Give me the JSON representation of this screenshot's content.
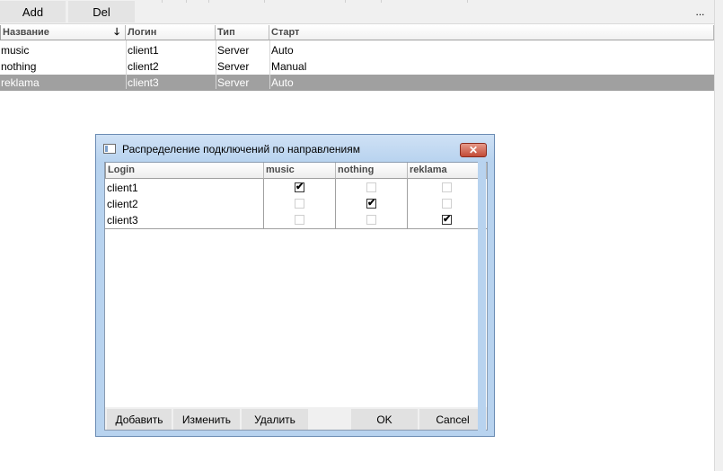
{
  "toolbar": {
    "add_label": "Add",
    "del_label": "Del",
    "more_label": "..."
  },
  "grid": {
    "columns": [
      "Название",
      "Логин",
      "Тип",
      "Старт"
    ],
    "sort_indicator": "🡓",
    "rows": [
      {
        "name": "music",
        "login": "client1",
        "type": "Server",
        "start": "Auto"
      },
      {
        "name": "nothing",
        "login": "client2",
        "type": "Server",
        "start": "Manual"
      },
      {
        "name": "reklama",
        "login": "client3",
        "type": "Server",
        "start": "Auto"
      }
    ],
    "selected_row": 2
  },
  "dialog": {
    "title": "Распределение подключений по направлениям",
    "close_glyph": "✕",
    "columns": [
      "Login",
      "music",
      "nothing",
      "reklama"
    ],
    "rows": [
      {
        "login": "client1",
        "checks": [
          true,
          false,
          false
        ]
      },
      {
        "login": "client2",
        "checks": [
          false,
          true,
          false
        ]
      },
      {
        "login": "client3",
        "checks": [
          false,
          false,
          true
        ]
      }
    ],
    "check_glyph": "✔",
    "buttons": {
      "add": "Добавить",
      "edit": "Изменить",
      "delete": "Удалить",
      "ok": "OK",
      "cancel": "Cancel"
    }
  },
  "colors": {
    "selected_row": "#a0a0a0",
    "dialog_frame": "#b8d3ef",
    "close_button": "#c24b37"
  }
}
